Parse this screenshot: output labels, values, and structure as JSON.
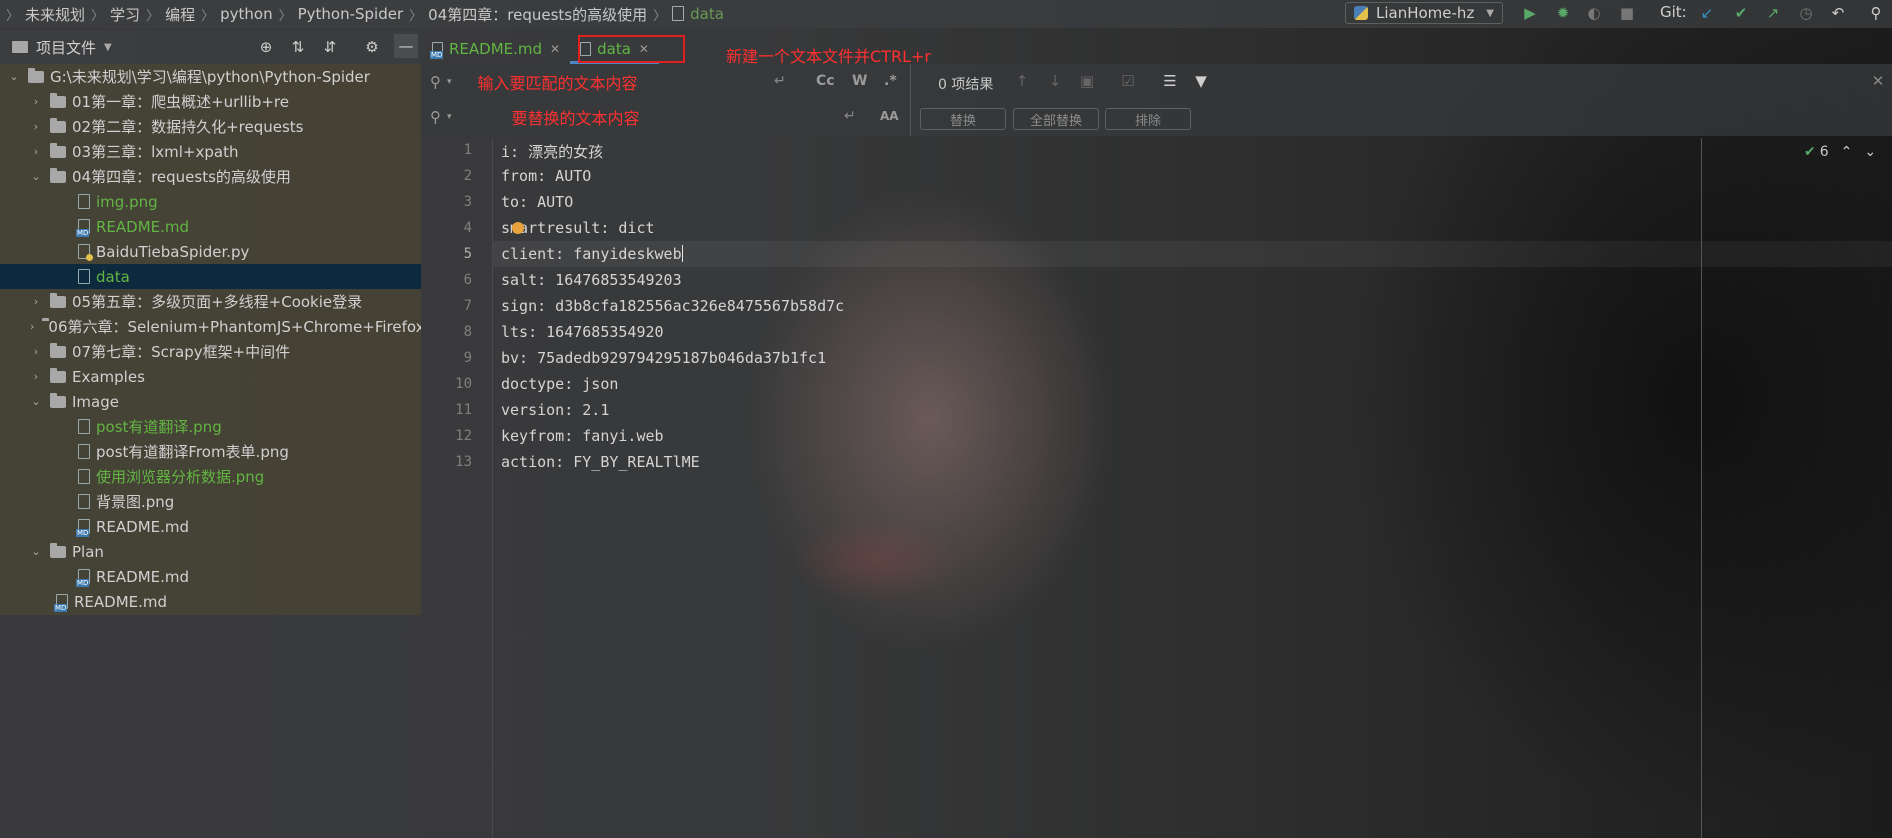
{
  "breadcrumbs": [
    "未来规划",
    "学习",
    "编程",
    "python",
    "Python-Spider",
    "04第四章：requests的高级使用",
    "data"
  ],
  "toolbar": {
    "run_config": "LianHome-hz",
    "git_label": "Git:"
  },
  "project_panel": {
    "title": "项目文件",
    "tree": [
      {
        "label": "G:\\未来规划\\学习\\编程\\python\\Python-Spider",
        "type": "folder",
        "expanded": true,
        "level": 0
      },
      {
        "label": "01第一章：爬虫概述+urllib+re",
        "type": "folder",
        "expanded": false,
        "level": 1
      },
      {
        "label": "02第二章：数据持久化+requests",
        "type": "folder",
        "expanded": false,
        "level": 1
      },
      {
        "label": "03第三章：lxml+xpath",
        "type": "folder",
        "expanded": false,
        "level": 1
      },
      {
        "label": "04第四章：requests的高级使用",
        "type": "folder",
        "expanded": true,
        "level": 1
      },
      {
        "label": "img.png",
        "type": "file",
        "color": "green",
        "level": 2
      },
      {
        "label": "README.md",
        "type": "md",
        "color": "green",
        "level": 2
      },
      {
        "label": "BaiduTiebaSpider.py",
        "type": "py",
        "color": "normal",
        "level": 2
      },
      {
        "label": "data",
        "type": "file",
        "color": "green",
        "level": 2,
        "selected": true
      },
      {
        "label": "05第五章：多级页面+多线程+Cookie登录",
        "type": "folder",
        "expanded": false,
        "level": 1
      },
      {
        "label": "06第六章：Selenium+PhantomJS+Chrome+Firefox",
        "type": "folder",
        "expanded": false,
        "level": 1
      },
      {
        "label": "07第七章：Scrapy框架+中间件",
        "type": "folder",
        "expanded": false,
        "level": 1
      },
      {
        "label": "Examples",
        "type": "folder",
        "expanded": false,
        "level": 1
      },
      {
        "label": "Image",
        "type": "folder",
        "expanded": true,
        "level": 1
      },
      {
        "label": "post有道翻译.png",
        "type": "file",
        "color": "green",
        "level": 2
      },
      {
        "label": "post有道翻译From表单.png",
        "type": "file",
        "color": "normal",
        "level": 2
      },
      {
        "label": "使用浏览器分析数据.png",
        "type": "file",
        "color": "green",
        "level": 2
      },
      {
        "label": "背景图.png",
        "type": "file",
        "color": "normal",
        "level": 2
      },
      {
        "label": "README.md",
        "type": "md",
        "color": "normal",
        "level": 2
      },
      {
        "label": "Plan",
        "type": "folder",
        "expanded": true,
        "level": 1
      },
      {
        "label": "README.md",
        "type": "md",
        "color": "normal",
        "level": 2
      },
      {
        "label": "README.md",
        "type": "md",
        "color": "normal",
        "level": 1
      }
    ]
  },
  "tabs": [
    {
      "label": "README.md",
      "active": false
    },
    {
      "label": "data",
      "active": true
    }
  ],
  "annotations": {
    "new_file": "新建一个文本文件并CTRL+r",
    "find_hint": "输入要匹配的文本内容",
    "replace_hint": "要替换的文本内容"
  },
  "find": {
    "match_case": "Cc",
    "words": "W",
    "regex": ".*",
    "preserve_case": "AA",
    "result_count": "0 项结果",
    "replace_button": "替换",
    "replace_all_button": "全部替换",
    "exclude_button": "排除"
  },
  "editor": {
    "inspection_count": "6",
    "lines": [
      "i: 漂亮的女孩",
      "from: AUTO",
      "to: AUTO",
      "smartresult: dict",
      "client: fanyideskweb",
      "salt: 16476853549203",
      "sign: d3b8cfa182556ac326e8475567b58d7c",
      "lts: 1647685354920",
      "bv: 75adedb929794295187b046da37b1fc1",
      "doctype: json",
      "version: 2.1",
      "keyfrom: fanyi.web",
      "action: FY_BY_REALTlME"
    ],
    "current_line": 5
  }
}
